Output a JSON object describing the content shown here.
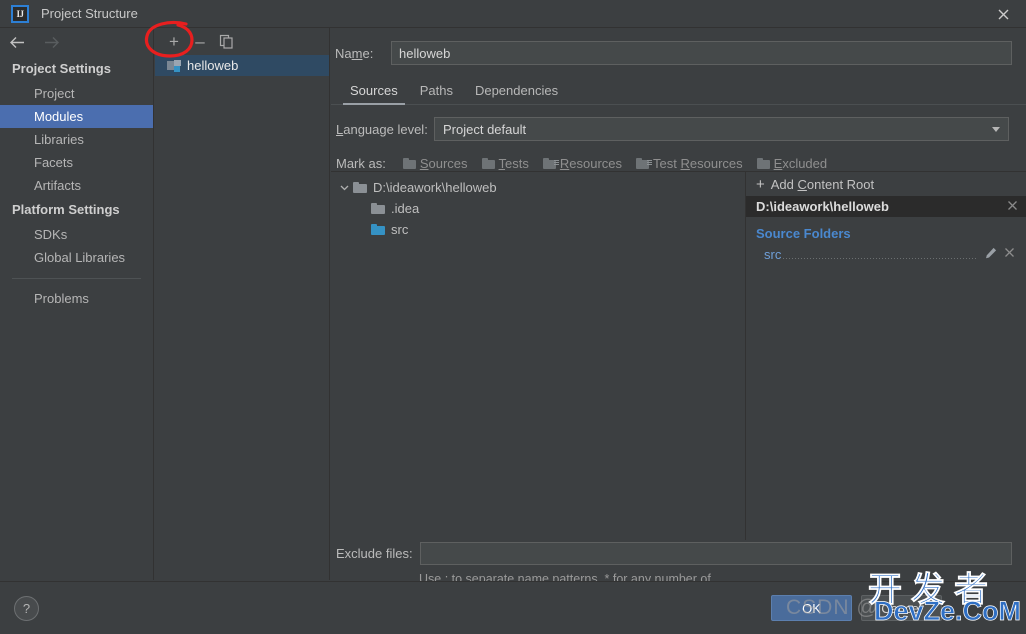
{
  "window": {
    "title": "Project Structure",
    "logo_text": "IJ",
    "close_icon": "close-icon"
  },
  "nav": {
    "back_icon": "arrow-left-icon",
    "forward_icon": "arrow-right-icon"
  },
  "sidebar": {
    "groups": [
      {
        "label": "Project Settings",
        "items": [
          {
            "label": "Project",
            "selected": false
          },
          {
            "label": "Modules",
            "selected": true
          },
          {
            "label": "Libraries",
            "selected": false
          },
          {
            "label": "Facets",
            "selected": false
          },
          {
            "label": "Artifacts",
            "selected": false
          }
        ]
      },
      {
        "label": "Platform Settings",
        "items": [
          {
            "label": "SDKs",
            "selected": false
          },
          {
            "label": "Global Libraries",
            "selected": false
          }
        ]
      }
    ],
    "problems_label": "Problems"
  },
  "modules_panel": {
    "toolbar": {
      "add_label": "+",
      "remove_label": "–",
      "copy_icon": "copy-icon"
    },
    "modules": [
      {
        "name": "helloweb",
        "selected": true
      }
    ]
  },
  "main": {
    "name_label_pre": "Na",
    "name_label_key": "m",
    "name_label_post": "e:",
    "name_value": "helloweb",
    "tabs": [
      {
        "label": "Sources",
        "active": true
      },
      {
        "label": "Paths",
        "active": false
      },
      {
        "label": "Dependencies",
        "active": false
      }
    ],
    "language_level": {
      "label_pre": "",
      "label_key": "L",
      "label_post": "anguage level:",
      "value": "Project default"
    },
    "mark_as": {
      "label": "Mark as:",
      "options": [
        {
          "pre": "",
          "key": "S",
          "post": "ources",
          "icon": "folder-sources-icon"
        },
        {
          "pre": "",
          "key": "T",
          "post": "ests",
          "icon": "folder-tests-icon"
        },
        {
          "pre": "",
          "key": "R",
          "post": "esources",
          "icon": "folder-resources-icon"
        },
        {
          "pre": "Test ",
          "key": "R",
          "post": "esources",
          "icon": "folder-test-resources-icon"
        },
        {
          "pre": "",
          "key": "E",
          "post": "xcluded",
          "icon": "folder-excluded-icon"
        }
      ]
    },
    "tree": [
      {
        "label": "D:\\ideawork\\helloweb",
        "depth": 0,
        "expanded": true,
        "color": "gray"
      },
      {
        "label": ".idea",
        "depth": 1,
        "expanded": null,
        "color": "gray"
      },
      {
        "label": "src",
        "depth": 1,
        "expanded": null,
        "color": "blue"
      }
    ],
    "content_roots": {
      "add_label_pre": "Add ",
      "add_label_key": "C",
      "add_label_post": "ontent Root",
      "plus_icon": "plus-icon",
      "root_path": "D:\\ideawork\\helloweb",
      "root_remove_icon": "close-icon",
      "source_folders_title": "Source Folders",
      "source_folders": [
        {
          "name": "src",
          "edit_icon": "pencil-icon",
          "remove_icon": "close-icon"
        }
      ]
    },
    "exclude": {
      "label": "Exclude files:",
      "value": "",
      "hint": "Use ; to separate name patterns, * for any number of symbols, ? for one."
    }
  },
  "footer": {
    "help_label": "?",
    "ok_label": "OK",
    "cancel_label": "Cancel"
  },
  "annotation": {
    "type": "red-ellipse",
    "target": "add-module-button",
    "color": "#e81f1f"
  },
  "watermark": {
    "gray_text": "CSDN @",
    "chinese_text": "开发者",
    "site_text": "DevZe.CoM",
    "color": "#2f6fc4"
  }
}
